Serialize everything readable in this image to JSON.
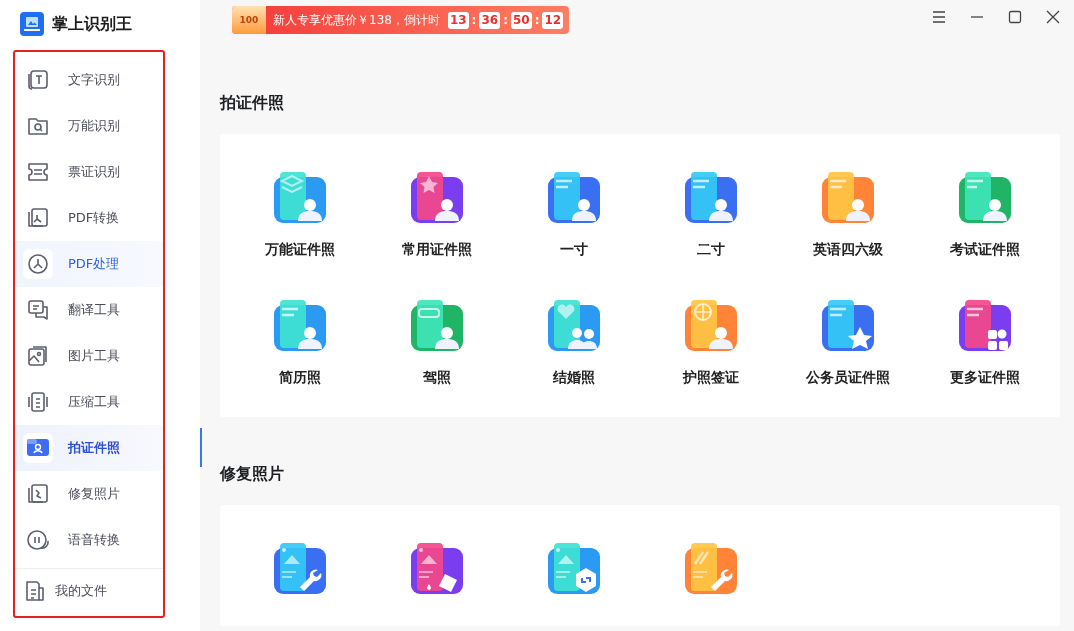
{
  "app": {
    "title": "掌上识别王"
  },
  "sidebar": {
    "items": [
      {
        "label": "文字识别",
        "selected": false,
        "hovered": false
      },
      {
        "label": "万能识别",
        "selected": false,
        "hovered": false
      },
      {
        "label": "票证识别",
        "selected": false,
        "hovered": false
      },
      {
        "label": "PDF转换",
        "selected": false,
        "hovered": false
      },
      {
        "label": "PDF处理",
        "selected": false,
        "hovered": true
      },
      {
        "label": "翻译工具",
        "selected": false,
        "hovered": false
      },
      {
        "label": "图片工具",
        "selected": false,
        "hovered": false
      },
      {
        "label": "压缩工具",
        "selected": false,
        "hovered": false
      },
      {
        "label": "拍证件照",
        "selected": true,
        "hovered": false
      },
      {
        "label": "修复照片",
        "selected": false,
        "hovered": false
      },
      {
        "label": "语音转换",
        "selected": false,
        "hovered": false
      }
    ],
    "footer_item": "我的文件"
  },
  "promo": {
    "badge": "100",
    "text": "新人专享优惠价￥138，倒计时",
    "countdown": [
      "13",
      "36",
      "50",
      "12"
    ],
    "separators": [
      ":",
      ":",
      ":"
    ]
  },
  "sections": [
    {
      "title": "拍证件照",
      "tiles": [
        {
          "kind": "layers",
          "label": "万能证件照"
        },
        {
          "kind": "star",
          "label": "常用证件照"
        },
        {
          "kind": "one",
          "label": "一寸"
        },
        {
          "kind": "two",
          "label": "二寸"
        },
        {
          "kind": "cet",
          "label": "英语四六级"
        },
        {
          "kind": "exam",
          "label": "考试证件照"
        },
        {
          "kind": "resume",
          "label": "简历照"
        },
        {
          "kind": "car",
          "label": "驾照"
        },
        {
          "kind": "heart",
          "label": "结婚照"
        },
        {
          "kind": "globe",
          "label": "护照签证"
        },
        {
          "kind": "badge",
          "label": "公务员证件照"
        },
        {
          "kind": "more",
          "label": "更多证件照"
        }
      ]
    },
    {
      "title": "修复照片",
      "tiles": [
        {
          "kind": "wrench"
        },
        {
          "kind": "eraser"
        },
        {
          "kind": "hexagon"
        },
        {
          "kind": "brush"
        }
      ]
    }
  ]
}
